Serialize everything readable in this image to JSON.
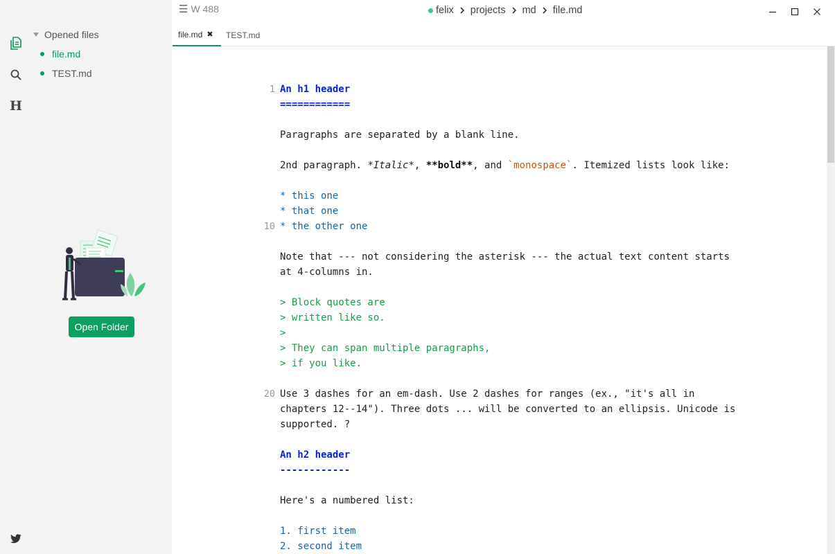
{
  "titlebar": {
    "word_count": "W 488",
    "breadcrumb": [
      "felix",
      "projects",
      "md",
      "file.md"
    ]
  },
  "sidebar": {
    "section_label": "Opened files",
    "files": [
      {
        "name": "file.md",
        "active": true
      },
      {
        "name": "TEST.md",
        "active": false
      }
    ],
    "open_folder_label": "Open Folder",
    "activity_icons": [
      "files-icon",
      "search-icon",
      "heading-icon",
      "twitter-icon"
    ],
    "heading_glyph": "H"
  },
  "tabs": [
    {
      "label": "file.md",
      "active": true
    },
    {
      "label": "TEST.md",
      "active": false
    }
  ],
  "editor": {
    "line_numbers": {
      "1": "1",
      "10": "10",
      "20": "20"
    },
    "lines": [
      {
        "n": "1",
        "text": "An h1 header"
      },
      {
        "n": "",
        "text": "============"
      },
      {
        "n": "",
        "text": ""
      },
      {
        "n": "",
        "text": "Paragraphs are separated by a blank line."
      },
      {
        "n": "",
        "text": ""
      },
      {
        "n": "",
        "text": "2nd paragraph. *Italic*, **bold**, and `monospace`. Itemized lists look like:"
      },
      {
        "n": "",
        "text": ""
      },
      {
        "n": "",
        "text": "* this one"
      },
      {
        "n": "",
        "text": "* that one"
      },
      {
        "n": "10",
        "text": "* the other one"
      },
      {
        "n": "",
        "text": ""
      },
      {
        "n": "",
        "text": "Note that --- not considering the asterisk --- the actual text content starts"
      },
      {
        "n": "",
        "text": "at 4-columns in."
      },
      {
        "n": "",
        "text": ""
      },
      {
        "n": "",
        "text": "> Block quotes are"
      },
      {
        "n": "",
        "text": "> written like so."
      },
      {
        "n": "",
        "text": ">"
      },
      {
        "n": "",
        "text": "> They can span multiple paragraphs,"
      },
      {
        "n": "",
        "text": "> if you like."
      },
      {
        "n": "",
        "text": ""
      },
      {
        "n": "20",
        "text": "Use 3 dashes for an em-dash. Use 2 dashes for ranges (ex., \"it's all in"
      },
      {
        "n": "",
        "text": "chapters 12--14\"). Three dots ... will be converted to an ellipsis. Unicode is"
      },
      {
        "n": "",
        "text": "supported. ?"
      },
      {
        "n": "",
        "text": ""
      },
      {
        "n": "",
        "text": "An h2 header"
      },
      {
        "n": "",
        "text": "------------"
      },
      {
        "n": "",
        "text": ""
      },
      {
        "n": "",
        "text": "Here's a numbered list:"
      },
      {
        "n": "",
        "text": ""
      },
      {
        "n": "",
        "text": "1. first item"
      },
      {
        "n": "",
        "text": "2. second item"
      }
    ],
    "para2": {
      "a": "2nd paragraph. ",
      "b": "*Italic*",
      "c": ", ",
      "d": "**bold**",
      "e": ", and ",
      "f": "`monospace`",
      "g": ". Itemized lists look like:"
    }
  },
  "colors": {
    "accent": "#0a9b5c",
    "heading": "#0a23d8",
    "list": "#1565a8",
    "quote": "#14a04a",
    "code": "#c0561a"
  }
}
